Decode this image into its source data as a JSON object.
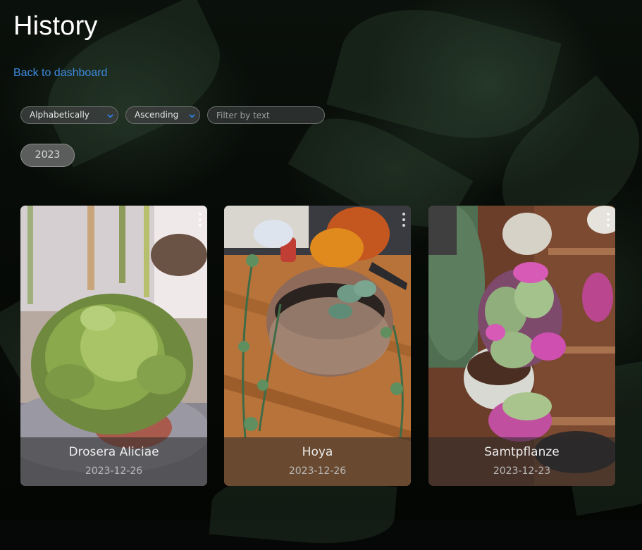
{
  "page": {
    "title": "History",
    "back_link": "Back to dashboard"
  },
  "filters": {
    "sort_by": "Alphabetically",
    "order": "Ascending",
    "filter_placeholder": "Filter by text",
    "year_chip": "2023"
  },
  "cards": [
    {
      "name": "Drosera Aliciae",
      "date": "2023-12-26"
    },
    {
      "name": "Hoya",
      "date": "2023-12-26"
    },
    {
      "name": "Samtpflanze",
      "date": "2023-12-23"
    }
  ],
  "colors": {
    "link": "#3d8bdf",
    "chevron": "#2f7ce0",
    "background": "#050806"
  },
  "icons": {
    "select_chevron": "chevron-down-icon",
    "card_menu": "more-vertical-icon"
  }
}
